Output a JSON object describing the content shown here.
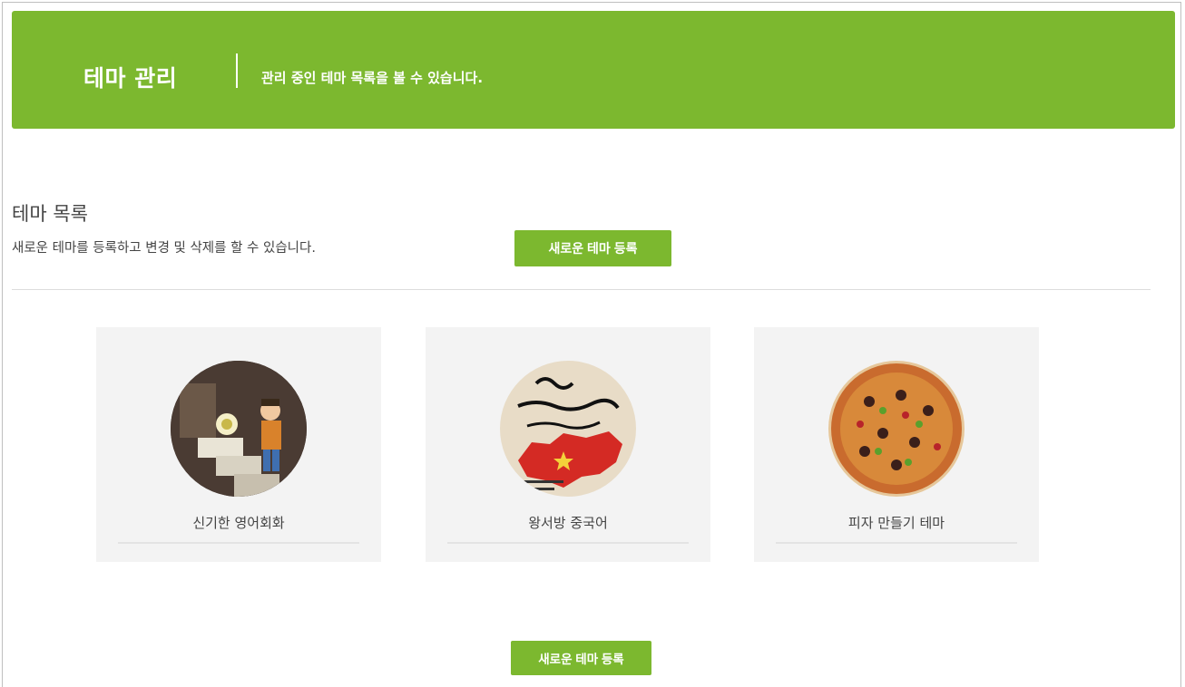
{
  "header": {
    "title": "테마 관리",
    "subtitle": "관리 중인 테마 목록을 볼 수 있습니다."
  },
  "section": {
    "title": "테마 목록",
    "description": "새로운 테마를 등록하고 변경 및 삭제를 할 수 있습니다.",
    "add_button_label": "새로운 테마 등록"
  },
  "themes": [
    {
      "label": "신기한 영어회화",
      "image": "cartoon-escape-room-thumbnail"
    },
    {
      "label": "왕서방 중국어",
      "image": "china-map-calligraphy-thumbnail"
    },
    {
      "label": "피자 만들기 테마",
      "image": "pizza-thumbnail"
    }
  ],
  "footer": {
    "add_button_label": "새로운 테마 등록"
  },
  "colors": {
    "accent": "#7cb82f",
    "card_bg": "#f3f3f3"
  }
}
